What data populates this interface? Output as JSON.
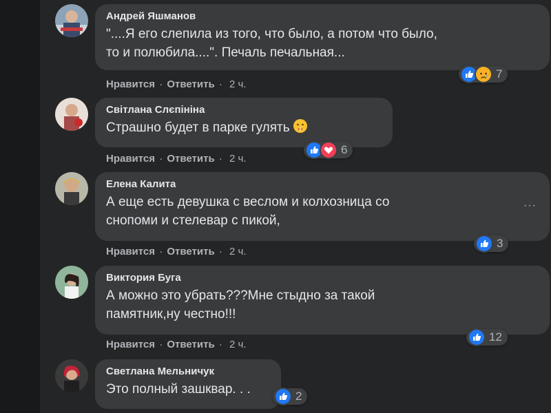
{
  "actions": {
    "like": "Нравится",
    "reply": "Ответить",
    "dot": "·"
  },
  "comments": [
    {
      "author": "Андрей Яшманов",
      "text": "\"....Я его слепила из того, что было, а потом что было,\nто и полюбила....\". Печаль печальная...",
      "time": "2 ч.",
      "reactions": [
        "like-icon",
        "sad-icon"
      ],
      "reaction_count": "7"
    },
    {
      "author": "Світлана Слєпініна",
      "text": "Страшно будет в парке гулять",
      "emoji": "shushing-face-emoji",
      "time": "2 ч.",
      "reactions": [
        "like-icon",
        "love-icon"
      ],
      "reaction_count": "6"
    },
    {
      "author": "Елена Калита",
      "text": "А еще есть девушка с веслом и колхозница со\nснопоми и стелевар с пикой,",
      "time": "2 ч.",
      "reactions": [
        "like-icon"
      ],
      "reaction_count": "3"
    },
    {
      "author": "Виктория Буга",
      "text": "А можно это убрать???Мне стыдно за такой\nпамятник,ну честно!!!",
      "time": "2 ч.",
      "reactions": [
        "like-icon"
      ],
      "reaction_count": "12"
    },
    {
      "author": "Светлана Мельничук",
      "text": "Это полный зашквар. . .",
      "reactions": [
        "like-icon"
      ],
      "reaction_count": "2"
    }
  ],
  "more_options": "···",
  "colors": {
    "like": "#2078f4",
    "love": "#f33e58",
    "sad": "#f7b125"
  }
}
